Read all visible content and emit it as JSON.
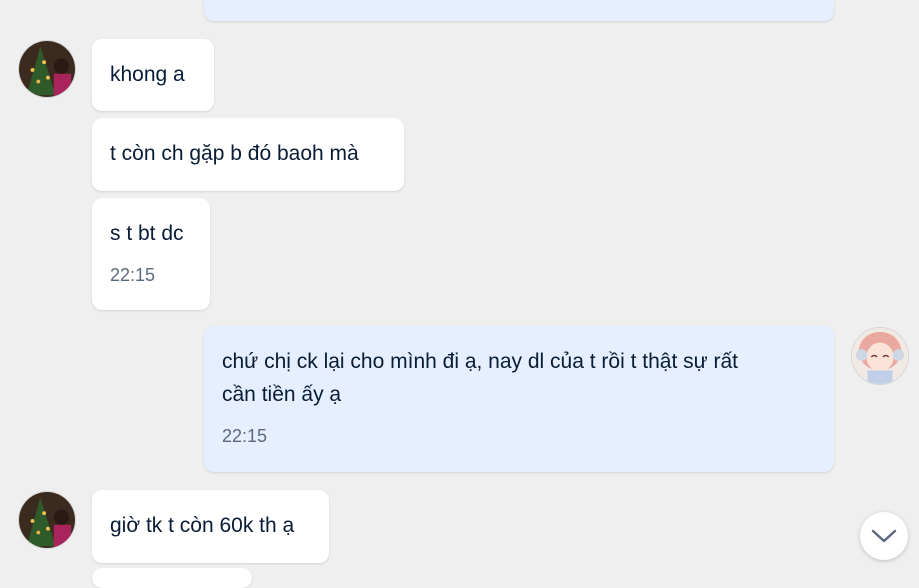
{
  "conversation": {
    "messages": [
      {
        "sender": "contact",
        "text": "khong a",
        "time": ""
      },
      {
        "sender": "contact",
        "text": "t còn ch gặp b đó baoh mà",
        "time": ""
      },
      {
        "sender": "contact",
        "text": "s t bt dc",
        "time": "22:15"
      },
      {
        "sender": "me",
        "text_line1": "chứ chị ck lại cho mình đi ạ, nay dl của t rồi t thật sự rất",
        "text_line2": "cần tiền ấy ạ",
        "time": "22:15"
      },
      {
        "sender": "contact",
        "text": "giờ tk t còn 60k th ạ",
        "time": ""
      }
    ]
  },
  "icons": {
    "scroll_down": "chevron-down-icon",
    "contact_avatar": "contact-avatar-photo",
    "my_avatar": "anime-girl-avatar"
  },
  "colors": {
    "background": "#efefef",
    "incoming_bubble": "#ffffff",
    "outgoing_bubble": "#e5efff",
    "text": "#081c36",
    "timestamp": "#5c6a7d"
  }
}
